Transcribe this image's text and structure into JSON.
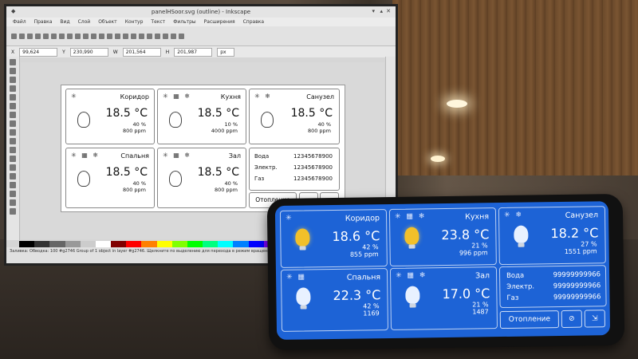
{
  "inkscape": {
    "title": "panelHSoor.svg (outline) - Inkscape",
    "menu": [
      "Файл",
      "Правка",
      "Вид",
      "Слой",
      "Объект",
      "Контур",
      "Текст",
      "Фильтры",
      "Расширения",
      "Справка"
    ],
    "toolbar_fields": {
      "x": "99,624",
      "y": "230,990",
      "w": "201,564",
      "h": "201,987",
      "unit": "px"
    },
    "status_text": "Group of 1 object in layer #g2746. Щелкните по выделению для перехода в режим вращения/наклона",
    "zoom": "100",
    "layer": "#g2746",
    "fill_label": "Заливка:",
    "stroke_label": "Обводка:",
    "cards": [
      {
        "title": "Коридор",
        "temp": "18.5 °C",
        "humidity": "40 %",
        "co2": "800 ppm"
      },
      {
        "title": "Кухня",
        "temp": "18.5 °C",
        "humidity": "10 %",
        "co2": "4000 ppm"
      },
      {
        "title": "Санузел",
        "temp": "18.5 °C",
        "humidity": "40 %",
        "co2": "800 ppm"
      },
      {
        "title": "Спальня",
        "temp": "18.5 °C",
        "humidity": "40 %",
        "co2": "800 ppm"
      },
      {
        "title": "Зал",
        "temp": "18.5 °C",
        "humidity": "40 %",
        "co2": "800 ppm"
      }
    ],
    "info": [
      {
        "label": "Вода",
        "value": "12345678900"
      },
      {
        "label": "Электр.",
        "value": "12345678900"
      },
      {
        "label": "Газ",
        "value": "12345678900"
      }
    ],
    "heating_label": "Отопление"
  },
  "phone": {
    "cards": [
      {
        "title": "Коридор",
        "temp": "18.6 °C",
        "humidity": "42 %",
        "co2": "855 ppm",
        "bulb": "on"
      },
      {
        "title": "Кухня",
        "temp": "23.8 °C",
        "humidity": "21 %",
        "co2": "996 ppm",
        "bulb": "on"
      },
      {
        "title": "Санузел",
        "temp": "18.2 °C",
        "humidity": "27 %",
        "co2": "1551 ppm",
        "bulb": "off"
      },
      {
        "title": "Спальня",
        "temp": "22.3 °C",
        "humidity": "42 %",
        "co2": "1169",
        "bulb": "off"
      },
      {
        "title": "Зал",
        "temp": "17.0 °C",
        "humidity": "21 %",
        "co2": "1487",
        "bulb": "off"
      }
    ],
    "info": [
      {
        "label": "Вода",
        "value": "99999999966"
      },
      {
        "label": "Электр.",
        "value": "99999999966"
      },
      {
        "label": "Газ",
        "value": "99999999966"
      }
    ],
    "heating_label": "Отопление"
  },
  "colors": {
    "phone_bg": "#1d63d6",
    "bulb_on": "#f2c02a",
    "bulb_off": "#e8f1ff"
  }
}
